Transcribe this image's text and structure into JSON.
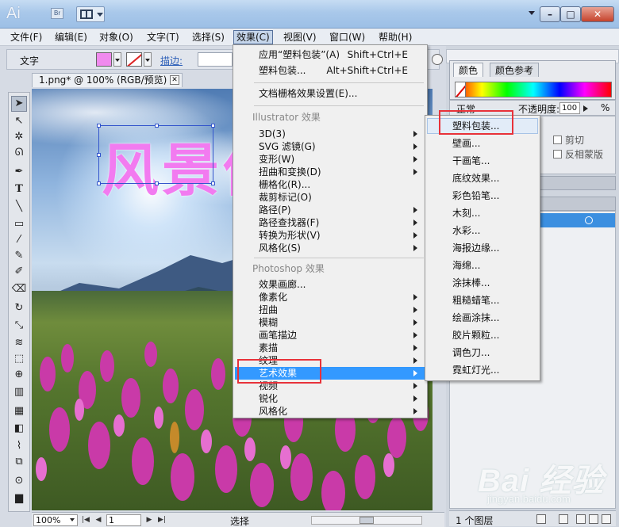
{
  "app": {
    "logo": "Ai",
    "bridge_badge": "Br"
  },
  "menubar": {
    "items": [
      "文件(F)",
      "编辑(E)",
      "对象(O)",
      "文字(T)",
      "选择(S)",
      "效果(C)",
      "视图(V)",
      "窗口(W)",
      "帮助(H)"
    ],
    "active": "效果(C)"
  },
  "control_bar": {
    "label": "文字",
    "fill_color": "#f08aee",
    "stroke_label": "描边:"
  },
  "document_tab": {
    "title": "1.png* @ 100% (RGB/预览)"
  },
  "canvas": {
    "banner_text": "风景佳"
  },
  "effects_menu": {
    "apply_last": "应用“塑料包装”(A)",
    "apply_last_shortcut": "Shift+Ctrl+E",
    "last_effect": "塑料包装...",
    "last_effect_shortcut": "Alt+Shift+Ctrl+E",
    "doc_raster": "文档栅格效果设置(E)...",
    "illustrator_header": "Illustrator 效果",
    "illustrator_items": [
      "3D(3)",
      "SVG 滤镜(G)",
      "变形(W)",
      "扭曲和变换(D)",
      "栅格化(R)...",
      "裁剪标记(O)",
      "路径(P)",
      "路径查找器(F)",
      "转换为形状(V)",
      "风格化(S)"
    ],
    "photoshop_header": "Photoshop 效果",
    "photoshop_items": [
      "效果画廊...",
      "像素化",
      "扭曲",
      "模糊",
      "画笔描边",
      "素描",
      "纹理",
      "艺术效果",
      "视频",
      "锐化",
      "风格化"
    ],
    "highlighted": "艺术效果"
  },
  "artistic_submenu": {
    "items": [
      "塑料包装...",
      "壁画...",
      "干画笔...",
      "底纹效果...",
      "彩色铅笔...",
      "木刻...",
      "水彩...",
      "海报边缘...",
      "海绵...",
      "涂抹棒...",
      "粗糙蜡笔...",
      "绘画涂抹...",
      "胶片颗粒...",
      "调色刀...",
      "霓虹灯光..."
    ],
    "hovered": "塑料包装..."
  },
  "panels": {
    "color_tab": "颜色",
    "color_guide_tab": "颜色参考",
    "blend_mode_partial": "正常",
    "opacity_label": "不透明度:",
    "opacity_value": "100",
    "opacity_unit": "%",
    "clip_label": "剪切",
    "invert_mask_label": "反相蒙版",
    "layer_count": "1 个图层"
  },
  "statusbar": {
    "zoom": "100%",
    "page": "1",
    "mode": "选择"
  },
  "watermark": {
    "logo": "Bai 经验",
    "url": "jingyan.baidu.com"
  },
  "colors": {
    "highlight": "#3399ff",
    "annotation_red": "#e8323a",
    "layer_selected": "#3b8fe0"
  }
}
